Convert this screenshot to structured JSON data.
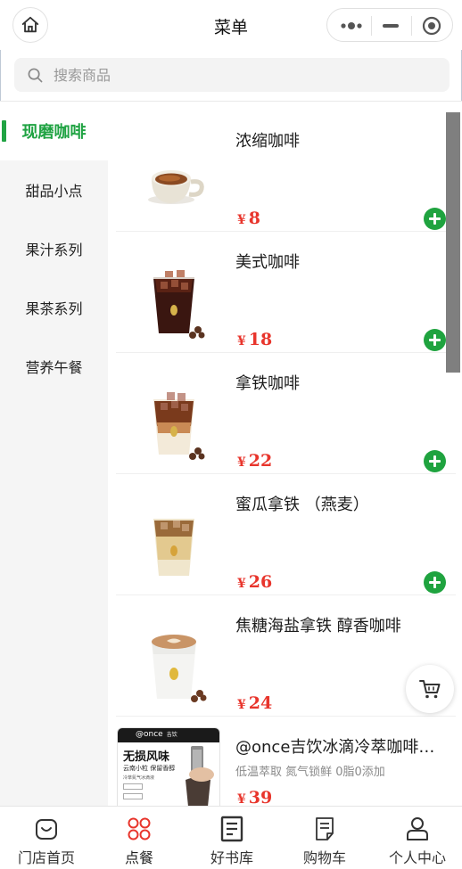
{
  "nav": {
    "title": "菜单"
  },
  "search": {
    "placeholder": "搜索商品"
  },
  "sidebar": {
    "items": [
      {
        "label": "现磨咖啡",
        "active": true
      },
      {
        "label": "甜品小点",
        "active": false
      },
      {
        "label": "果汁系列",
        "active": false
      },
      {
        "label": "果茶系列",
        "active": false
      },
      {
        "label": "营养午餐",
        "active": false
      }
    ]
  },
  "products": [
    {
      "name": "浓缩咖啡",
      "desc": "",
      "currency": "¥",
      "price": "8"
    },
    {
      "name": "美式咖啡",
      "desc": "",
      "currency": "¥",
      "price": "18"
    },
    {
      "name": "拿铁咖啡",
      "desc": "",
      "currency": "¥",
      "price": "22"
    },
    {
      "name": "蜜瓜拿铁 （燕麦）",
      "desc": "",
      "currency": "¥",
      "price": "26"
    },
    {
      "name": "焦糖海盐拿铁 醇香咖啡",
      "desc": "",
      "currency": "¥",
      "price": "24"
    },
    {
      "name": "@once吉饮冰滴冷萃咖啡…",
      "desc": "低温萃取 氮气锁鲜 0脂0添加",
      "currency": "¥",
      "price": "39",
      "package": {
        "brand": "@once",
        "brand_sub": "吉饮",
        "headline": "无损风味",
        "subline": "云南小粒 保留香醇",
        "note": "冷萃氮气冰滴液"
      }
    }
  ],
  "tabbar": {
    "items": [
      {
        "label": "门店首页",
        "icon": "shop-bag-icon",
        "active": false
      },
      {
        "label": "点餐",
        "icon": "order-grid-icon",
        "active": true
      },
      {
        "label": "好书库",
        "icon": "book-library-icon",
        "active": false
      },
      {
        "label": "购物车",
        "icon": "cart-list-icon",
        "active": false
      },
      {
        "label": "个人中心",
        "icon": "user-profile-icon",
        "active": false
      }
    ]
  },
  "colors": {
    "accent_green": "#20a343",
    "price_red": "#e8352c",
    "tab_active_red": "#e8352c",
    "sidebar_bg": "#f5f5f5"
  }
}
